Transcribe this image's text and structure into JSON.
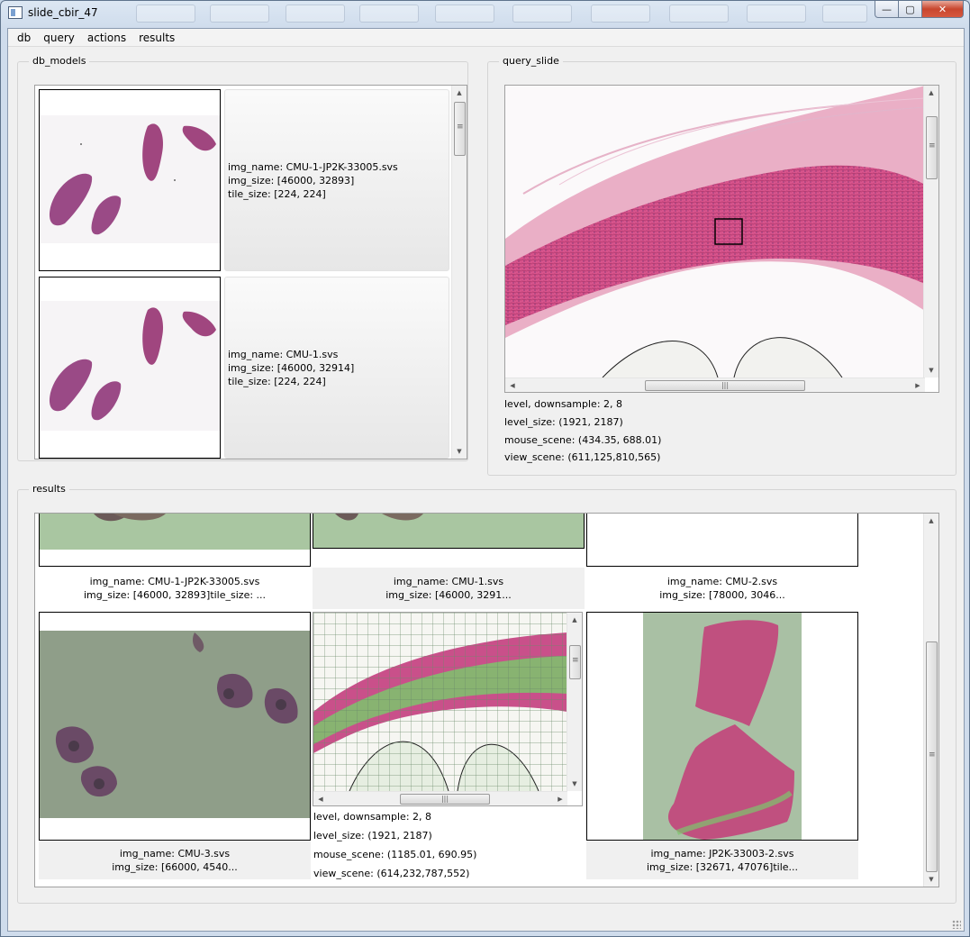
{
  "window": {
    "title": "slide_cbir_47",
    "minimize_glyph": "—",
    "maximize_glyph": "▢",
    "close_glyph": "✕"
  },
  "menu": [
    "db",
    "query",
    "actions",
    "results"
  ],
  "db_models": {
    "title": "db_models",
    "items": [
      {
        "lines": [
          "img_name: CMU-1-JP2K-33005.svs",
          "img_size: [46000, 32893]",
          "tile_size: [224, 224]"
        ]
      },
      {
        "lines": [
          "img_name: CMU-1.svs",
          "img_size: [46000, 32914]",
          "tile_size: [224, 224]"
        ]
      }
    ]
  },
  "query_slide": {
    "title": "query_slide",
    "level_downsample": "level, downsample: 2, 8",
    "level_size": "level_size: (1921, 2187)",
    "mouse_scene": "mouse_scene: (434.35, 688.01)",
    "view_scene": "view_scene: (611,125,810,565)"
  },
  "results": {
    "title": "results",
    "row1": [
      {
        "l1": "img_name: CMU-1-JP2K-33005.svs",
        "l2": "img_size: [46000, 32893]tile_size: ..."
      },
      {
        "l1": "img_name: CMU-1.svs",
        "l2": "img_size: [46000, 3291..."
      },
      {
        "l1": "img_name: CMU-2.svs",
        "l2": "img_size: [78000, 3046..."
      }
    ],
    "row2": [
      {
        "l1": "img_name: CMU-3.svs",
        "l2": "img_size: [66000, 4540..."
      },
      {
        "level_downsample": "level, downsample: 2, 8",
        "level_size": "level_size: (1921, 2187)",
        "mouse_scene": "mouse_scene: (1185.01, 690.95)",
        "view_scene": "view_scene: (614,232,787,552)"
      },
      {
        "l1": "img_name: JP2K-33003-2.svs",
        "l2": "img_size: [32671, 47076]tile..."
      }
    ]
  },
  "scroll_glyphs": {
    "up": "▲",
    "down": "▼",
    "left": "◀",
    "right": "▶",
    "grip": "|||"
  },
  "colors": {
    "tissue_pink": "#c0507f",
    "tissue_purple": "#8a4a86",
    "grid_green": "#a9c6a1",
    "titlebar": "#dce7f3",
    "close_red": "#c8462e"
  }
}
